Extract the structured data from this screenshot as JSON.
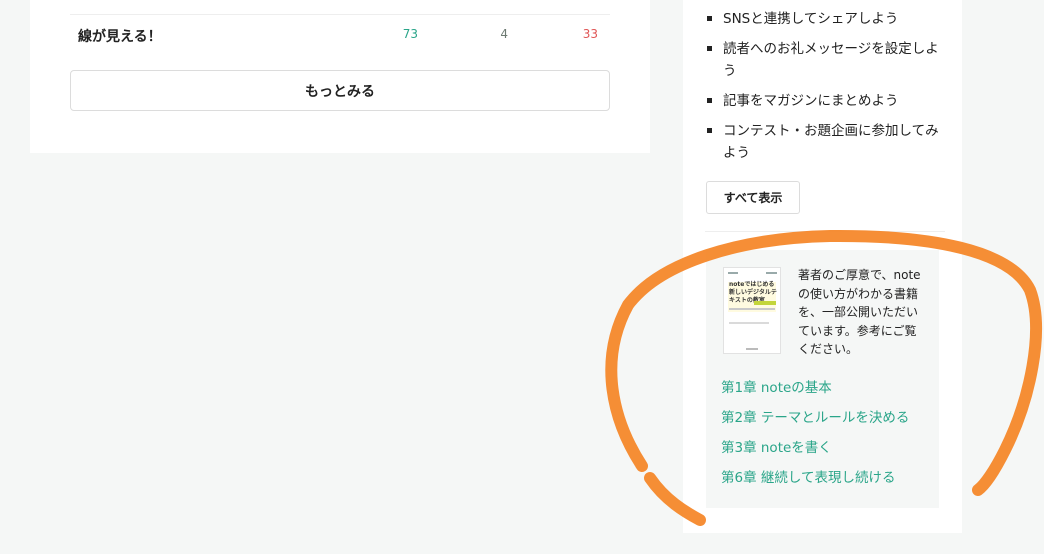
{
  "article_row": {
    "title": "線が見える！",
    "views": "73",
    "comments": "4",
    "likes": "33"
  },
  "more_button_label": "もっとみる",
  "sidebar": {
    "tips": [
      "SNSと連携してシェアしよう",
      "読者へのお礼メッセージを設定しよう",
      "記事をマガジンにまとめよう",
      "コンテスト・お題企画に参加してみよう"
    ],
    "show_all_label": "すべて表示",
    "book": {
      "cover_title": "noteではじめる新しいデジタルテキストの教室",
      "description": "著者のご厚意で、noteの使い方がわかる書籍を、一部公開いただいています。参考にご覧ください。"
    },
    "chapters": [
      "第1章 noteの基本",
      "第2章 テーマとルールを決める",
      "第3章 noteを書く",
      "第6章 継続して表現し続ける"
    ]
  },
  "colors": {
    "accent_green": "#2aa589",
    "like_red": "#e05656",
    "annotation_orange": "#f58220"
  }
}
